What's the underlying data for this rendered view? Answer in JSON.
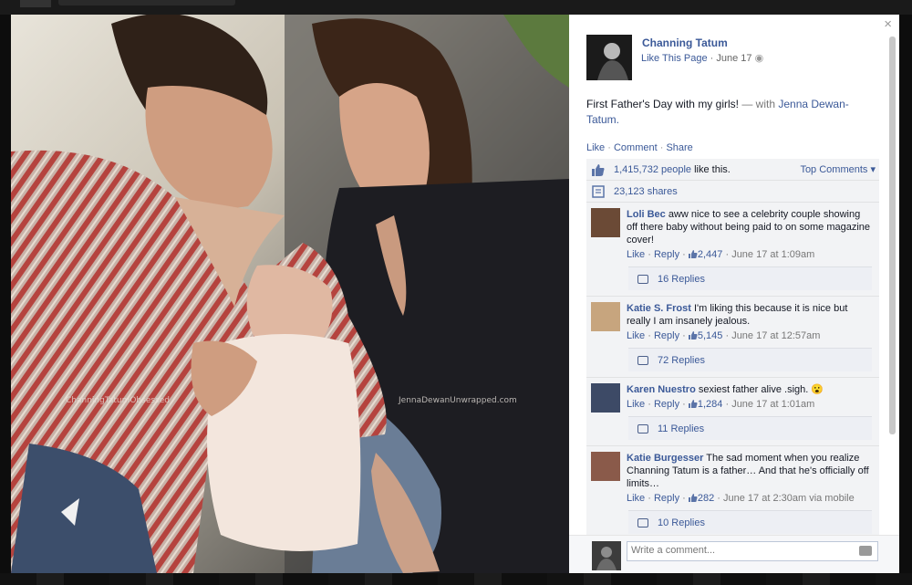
{
  "post": {
    "page_name": "Channing Tatum",
    "like_page": "Like This Page",
    "date": "June 17",
    "text": "First Father's Day with my girls!",
    "with_prefix": "— with",
    "tagged": "Jenna Dewan-Tatum."
  },
  "actions": {
    "like": "Like",
    "comment": "Comment",
    "share": "Share"
  },
  "stats": {
    "likes_count": "1,415,732 people",
    "likes_suffix": "like this.",
    "top_comments": "Top Comments ▾",
    "shares": "23,123 shares"
  },
  "comments": [
    {
      "author": "Loli Bec",
      "text": "aww nice to see a celebrity couple showing off there baby without being paid to on some magazine cover!",
      "like": "Like",
      "reply": "Reply",
      "likes": "2,447",
      "time": "June 17 at 1:09am",
      "replies": "16 Replies"
    },
    {
      "author": "Katie S. Frost",
      "text": "I'm liking this because it is nice but really I am insanely jealous.",
      "like": "Like",
      "reply": "Reply",
      "likes": "5,145",
      "time": "June 17 at 12:57am",
      "replies": "72 Replies"
    },
    {
      "author": "Karen Nuestro",
      "text": "sexiest father alive .sigh. 😮",
      "like": "Like",
      "reply": "Reply",
      "likes": "1,284",
      "time": "June 17 at 1:01am",
      "replies": "11 Replies"
    },
    {
      "author": "Katie Burgesser",
      "text": "The sad moment when you realize Channing Tatum is a father… And that he's officially off limits…",
      "like": "Like",
      "reply": "Reply",
      "likes": "282",
      "time": "June 17 at 2:30am via mobile",
      "replies": "10 Replies"
    }
  ],
  "composer": {
    "placeholder": "Write a comment..."
  },
  "close": "×",
  "watermark": {
    "left": "ChanningTatumObsessed",
    "right": "JennaDewanUnwrapped.com"
  }
}
